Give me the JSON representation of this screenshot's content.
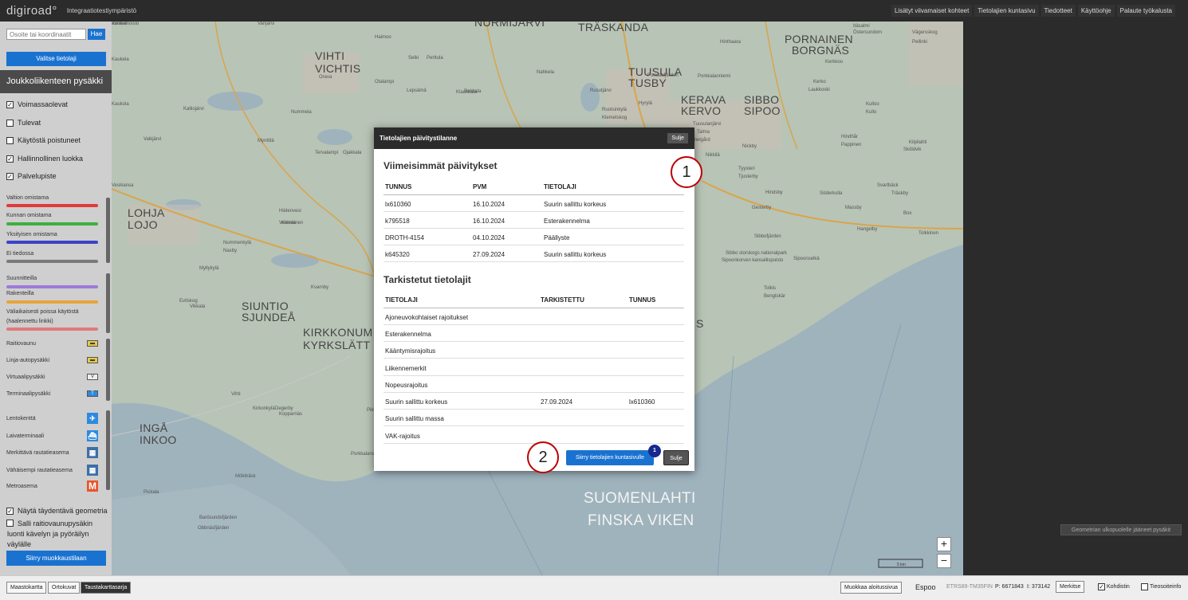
{
  "header": {
    "logo": "digiroad°",
    "environment": "Integraatiotestiympäristö",
    "links": [
      "Lisätyt viivamaiset kohteet",
      "Tietolajien kuntasivu",
      "Tiedotteet",
      "Käyttöohje",
      "Palaute työkalusta"
    ]
  },
  "sidebar": {
    "search_placeholder": "Osoite tai koordinaatit",
    "search_button": "Hae",
    "select_button": "Valitse tietolaji",
    "layer_title": "Joukkoliikenteen pysäkki",
    "filters": [
      {
        "label": "Voimassaolevat",
        "checked": "✓"
      },
      {
        "label": "Tulevat",
        "checked": ""
      },
      {
        "label": "Käytöstä poistuneet",
        "checked": ""
      },
      {
        "label": "Hallinnollinen luokka",
        "checked": "✓"
      },
      {
        "label": "Palvelupiste",
        "checked": "✓"
      }
    ],
    "admin_legend": [
      {
        "label": "Valtion omistama",
        "color": "#e03a3a"
      },
      {
        "label": "Kunnan omistama",
        "color": "#3fae3f"
      },
      {
        "label": "Yksityisen omistama",
        "color": "#3a44c8"
      },
      {
        "label": "Ei tiedossa",
        "color": "#7a7a7a"
      }
    ],
    "status_legend": [
      {
        "label": "Suunnitteilla",
        "color": "#9d7bd8"
      },
      {
        "label": "Rakenteilla",
        "color": "#e8a53a"
      },
      {
        "label": "Väliaikaisesti poissa käytöstä (haalennettu linkki)",
        "color": "#e07a7a"
      }
    ],
    "stop_types": [
      {
        "label": "Raitiovaunu",
        "symbol": "▬"
      },
      {
        "label": "Linja-autopysäkki",
        "symbol": "▬"
      },
      {
        "label": "Virtuaalipysäkki",
        "symbol": "V"
      },
      {
        "label": "Terminaalipysäkki",
        "symbol": "T"
      }
    ],
    "service_types": [
      {
        "label": "Lentokenttä",
        "symbol": "✈",
        "color": "#2d8ae0"
      },
      {
        "label": "Laivaterminaali",
        "symbol": "⛴",
        "color": "#2d8ae0"
      },
      {
        "label": "Merkittävä rautatieasema",
        "symbol": "▦",
        "color": "#3e6fa8"
      },
      {
        "label": "Vähäisempi rautatieasema",
        "symbol": "▦",
        "color": "#3e6fa8"
      },
      {
        "label": "Metroasema",
        "symbol": "M",
        "color": "#e8542b"
      }
    ],
    "options": [
      {
        "label": "Näytä täydentävä geometria",
        "checked": "✓"
      },
      {
        "label": "Salli raitiovaunupysäkin luonti kävelyn ja pyöräilyn väylälle",
        "checked": ""
      }
    ],
    "mode_button": "Siirry muokkaustilaan"
  },
  "map": {
    "labels": {
      "vihti": "VIHTI",
      "vichtis": "VICHTIS",
      "nurmijarvi": "NURMIJÄRVI",
      "traskanda": "TRÄSKANDA",
      "tuusula": "TUUSULA",
      "tusby": "TUSBY",
      "kerava": "KERAVA",
      "kervo": "KERVO",
      "sibbo": "SIBBO",
      "sipoo": "SIPOO",
      "pornainen": "PORNAINEN",
      "borgnas": "BORGNÄS",
      "lohja": "LOHJA",
      "lojo": "LOJO",
      "siuntio": "SIUNTIO",
      "sjundea": "SJUNDEÅ",
      "kirkkonummi": "KIRKKONUM",
      "kyrkslatt": "KYRKSLÄTT",
      "inga": "INGÅ",
      "inkoo": "INKOO",
      "suomenlahti": "SUOMENLAHTI",
      "finska_viken": "FINSKA VIKEN",
      "s": "S"
    },
    "small_labels": [
      "Kaukela",
      "Vanjärvi",
      "Haimoo",
      "Selki",
      "Perttula",
      "Orava",
      "Otalampi",
      "Lepsämä",
      "Klaukkala",
      "Pakkala",
      "Nahkela",
      "Rusutjärvi",
      "Ruotsinkylä",
      "Klemetskog",
      "Hyrylä",
      "Kaukola",
      "Valkjärvi",
      "Mynttilä",
      "Nummela",
      "Ojakkala",
      "Tervalampi",
      "Kalliojärvi",
      "Vesikansa",
      "Hiidenvesi",
      "Karnainen",
      "Vekkola",
      "Nummenkylä",
      "Nasby",
      "Myllykylä",
      "Kvarnby",
      "Vikkala",
      "Evitskog",
      "Lappers",
      "Vihti",
      "Kirkonkylä",
      "Degerby",
      "Kopparnäs",
      "Pikkala",
      "Pickala",
      "Mökiträsk",
      "Barösundsfjärden",
      "Obbnäsfjärden",
      "Porkkalanselkä",
      "Porkalafjärden",
      "Porkkalanniemi",
      "Tuusulanjärvi",
      "Talma",
      "Nickby",
      "Nikkilä",
      "Hindsby",
      "Gesterby",
      "Söderkulla",
      "Massby",
      "Box",
      "Hangelby",
      "Svartbäck",
      "Träskby",
      "Kilpilahti",
      "Sköldvik",
      "Tolkkinen",
      "Tolkis",
      "Bengtskär",
      "Sibbofjärden",
      "Sipoonselkä",
      "Vägersskog",
      "Pellinki",
      "Kerkkoo",
      "Kerko",
      "Laukkoski",
      "Hinthaara",
      "Hindhår",
      "Pappinen",
      "Kulloo",
      "Kullo",
      "Tyysteri",
      "Tjusterby",
      "Sipoonkorven kansallispuisto",
      "Sibbo storskogs nationalpark",
      "Östersundom",
      "Itäsalmi",
      "Gammelgård",
      "Vanhamoisio",
      "Kerava"
    ],
    "outside_button": "Geometrian ulkopuolelle jääneet pysäkit",
    "zoom_in": "+",
    "zoom_out": "−",
    "scale": "5 km"
  },
  "footer": {
    "map_types": [
      "Maastokartta",
      "Ortokuvat",
      "Taustakarttasarja"
    ],
    "active_map_type": "Taustakarttasarja",
    "edit_start_button": "Muokkaa aloitussivua",
    "municipality": "Espoo",
    "coord_system": "ETRS89-TM35FIN",
    "coord_p": "P: 6671843",
    "coord_i": "I: 373142",
    "mark_button": "Merkitse",
    "crosshair_label": "Kohdistin",
    "crosshair_checked": "✓",
    "roadinfo_label": "Tieosoiteinfo",
    "roadinfo_checked": ""
  },
  "modal": {
    "title": "Tietolajien päivitystilanne",
    "close_top": "Sulje",
    "recent_heading": "Viimeisimmät päivitykset",
    "recent_headers": [
      "TUNNUS",
      "PVM",
      "TIETOLAJI"
    ],
    "recent_rows": [
      [
        "lx610360",
        "16.10.2024",
        "Suurin sallittu korkeus"
      ],
      [
        "k795518",
        "16.10.2024",
        "Esterakennelma"
      ],
      [
        "DROTH-4154",
        "04.10.2024",
        "Päällyste"
      ],
      [
        "k645320",
        "27.09.2024",
        "Suurin sallittu korkeus"
      ]
    ],
    "checked_heading": "Tarkistetut tietolajit",
    "checked_headers": [
      "TIETOLAJI",
      "TARKISTETTU",
      "TUNNUS"
    ],
    "checked_rows": [
      [
        "Ajoneuvokohtaiset rajoitukset",
        "",
        ""
      ],
      [
        "Esterakennelma",
        "",
        ""
      ],
      [
        "Kääntymisrajoitus",
        "",
        ""
      ],
      [
        "Liikennemerkit",
        "",
        ""
      ],
      [
        "Nopeusrajoitus",
        "",
        ""
      ],
      [
        "Suurin sallittu korkeus",
        "27.09.2024",
        "lx610360"
      ],
      [
        "Suurin sallittu massa",
        "",
        ""
      ],
      [
        "VAK-rajoitus",
        "",
        ""
      ]
    ],
    "goto_button": "Siirry tietolajien kuntasivulle",
    "goto_badge": "1",
    "close_button": "Sulje"
  },
  "callouts": [
    "1",
    "2"
  ]
}
